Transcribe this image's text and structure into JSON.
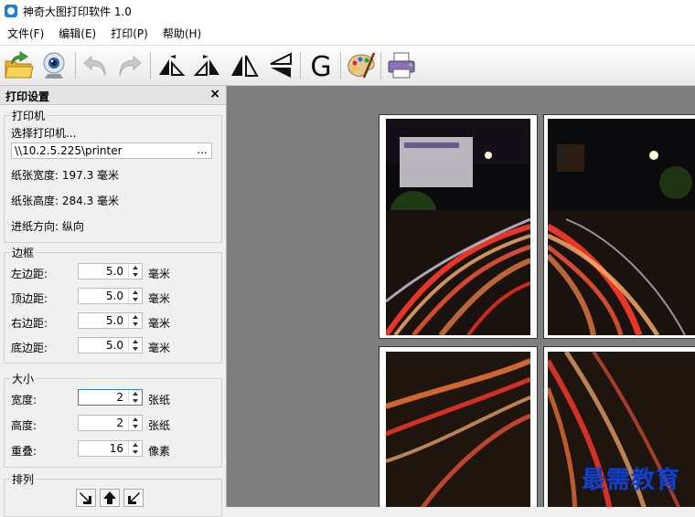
{
  "window": {
    "title": "神奇大图打印软件 1.0"
  },
  "menu": {
    "file": "文件(F)",
    "edit": "编辑(E)",
    "print": "打印(P)",
    "help": "帮助(H)"
  },
  "toolbar": {
    "icons": [
      "open-folder-icon",
      "webcam-icon",
      "undo-icon",
      "redo-icon",
      "flip-vertical-up-icon",
      "flip-vertical-down-icon",
      "mirror-horizontal-icon",
      "mirror-vertical-icon",
      "g-icon",
      "palette-icon",
      "printer-icon"
    ],
    "g_label": "G"
  },
  "panel": {
    "title": "打印设置",
    "close": "×",
    "printer": {
      "group_title": "打印机",
      "select_label": "选择打印机...",
      "printer_name": "\\\\10.2.5.225\\printer",
      "browse": "...",
      "paper_width": "纸张宽度: 197.3 毫米",
      "paper_height": "纸张高度: 284.3 毫米",
      "feed_direction": "进纸方向: 纵向"
    },
    "margins": {
      "group_title": "边框",
      "left_label": "左边距:",
      "left_value": "5.0",
      "top_label": "顶边距:",
      "top_value": "5.0",
      "right_label": "右边距:",
      "right_value": "5.0",
      "bottom_label": "底边距:",
      "bottom_value": "5.0",
      "unit": "毫米"
    },
    "size": {
      "group_title": "大小",
      "width_label": "宽度:",
      "width_value": "2",
      "width_unit": "张纸",
      "height_label": "高度:",
      "height_value": "2",
      "height_unit": "张纸",
      "overlap_label": "重叠:",
      "overlap_value": "16",
      "overlap_unit": "像素"
    },
    "arrange": {
      "group_title": "排列"
    }
  },
  "watermark": "最需教育",
  "colors": {
    "accent": "#1e7be0",
    "canvas_bg": "#7f7f7f",
    "watermark": "#1240c8"
  }
}
